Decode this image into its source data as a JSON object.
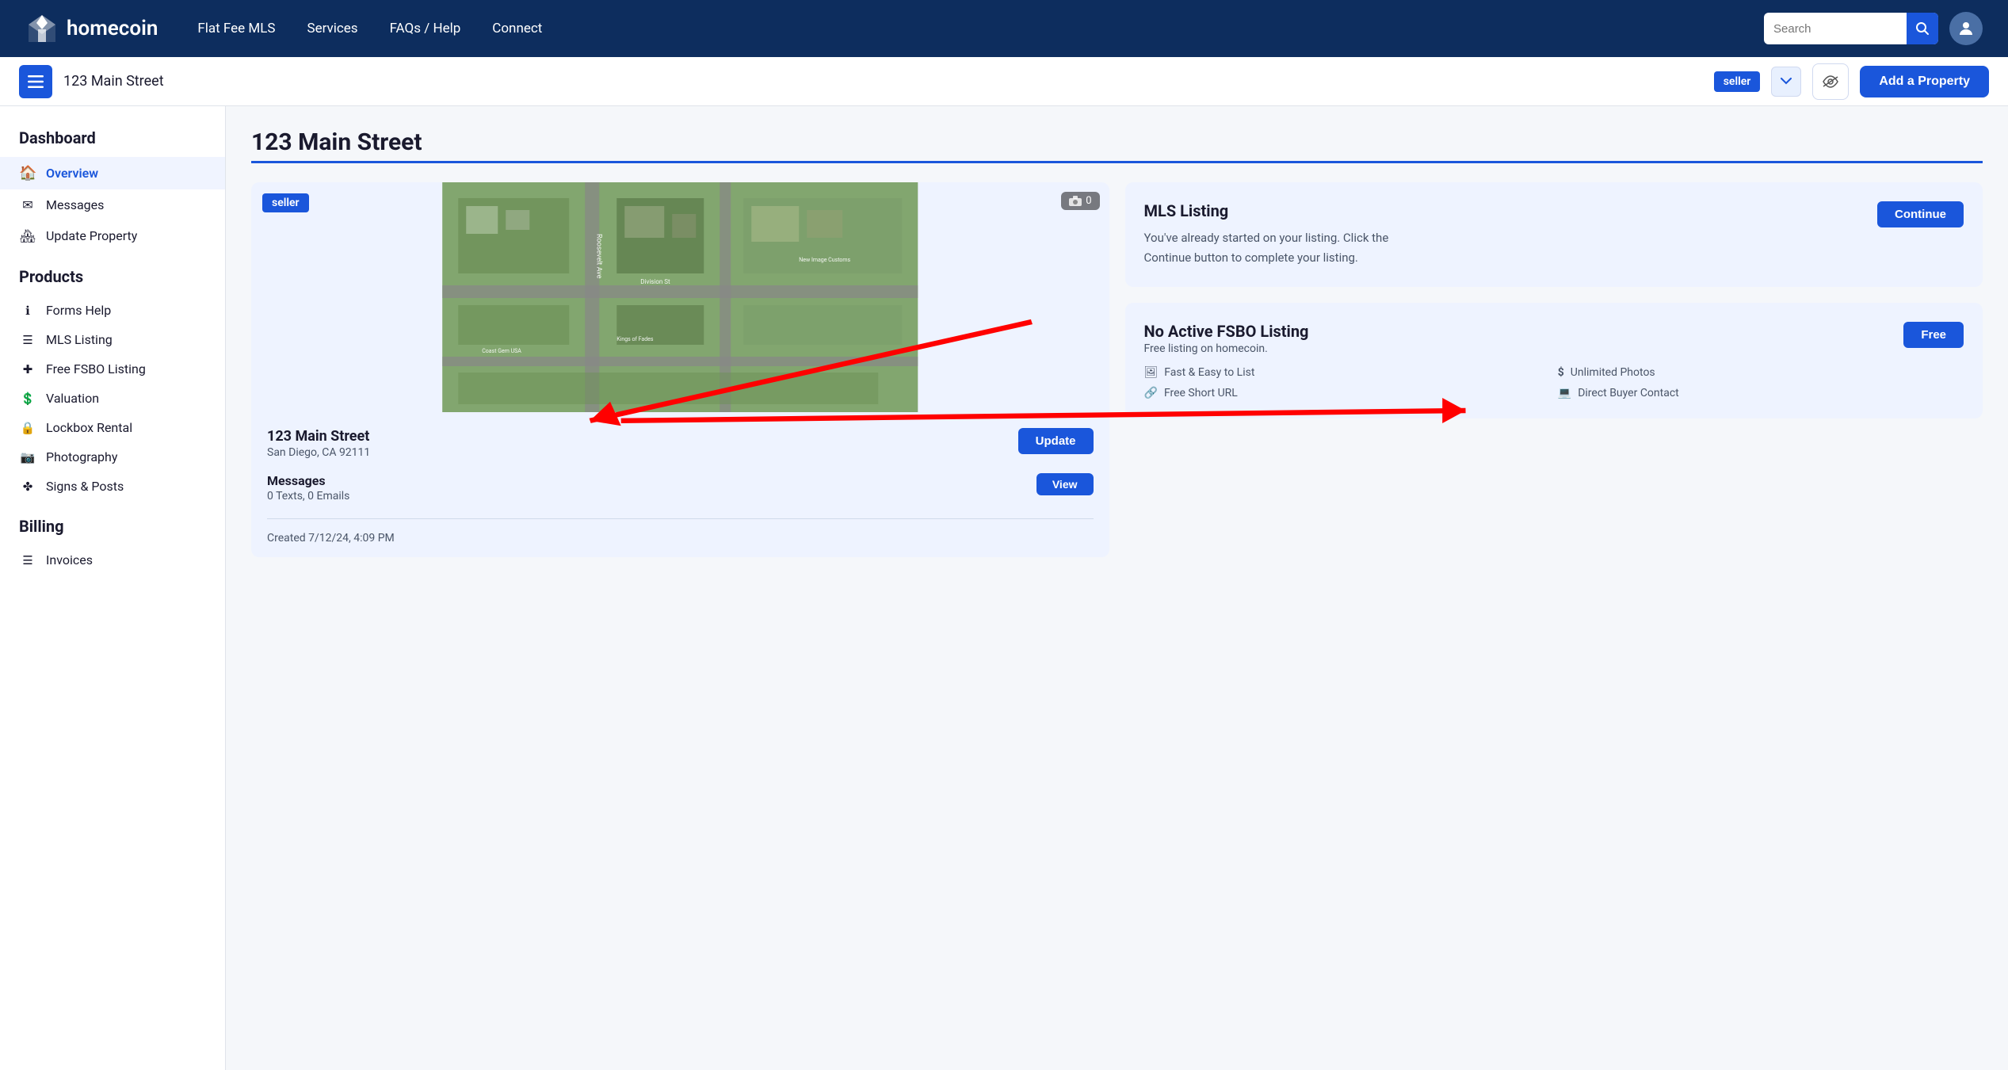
{
  "nav": {
    "logo_text": "homecoin",
    "links": [
      {
        "label": "Flat Fee MLS",
        "name": "flat-fee-mls"
      },
      {
        "label": "Services",
        "name": "services"
      },
      {
        "label": "FAQs / Help",
        "name": "faqs-help"
      },
      {
        "label": "Connect",
        "name": "connect"
      }
    ],
    "search_placeholder": "Search",
    "user_icon": "👤"
  },
  "toolbar": {
    "address": "123 Main Street",
    "seller_badge": "seller",
    "add_property_label": "Add a Property"
  },
  "sidebar": {
    "dashboard_title": "Dashboard",
    "items_top": [
      {
        "label": "Overview",
        "icon": "🏠",
        "name": "overview",
        "active": true
      },
      {
        "label": "Messages",
        "icon": "✉",
        "name": "messages",
        "active": false
      },
      {
        "label": "Update Property",
        "icon": "🏘",
        "name": "update-property",
        "active": false
      }
    ],
    "products_title": "Products",
    "items_products": [
      {
        "label": "Forms Help",
        "icon": "ℹ",
        "name": "forms-help"
      },
      {
        "label": "MLS Listing",
        "icon": "☰",
        "name": "mls-listing"
      },
      {
        "label": "Free FSBO Listing",
        "icon": "✚",
        "name": "free-fsbo-listing"
      },
      {
        "label": "Valuation",
        "icon": "💲",
        "name": "valuation"
      },
      {
        "label": "Lockbox Rental",
        "icon": "🔒",
        "name": "lockbox-rental"
      },
      {
        "label": "Photography",
        "icon": "📷",
        "name": "photography"
      },
      {
        "label": "Signs & Posts",
        "icon": "✤",
        "name": "signs-posts"
      }
    ],
    "billing_title": "Billing",
    "items_billing": [
      {
        "label": "Invoices",
        "icon": "☰",
        "name": "invoices"
      }
    ]
  },
  "content": {
    "page_title": "123 Main Street",
    "property": {
      "seller_tag": "seller",
      "camera_count": "0",
      "address": "123 Main Street",
      "city_state": "San Diego, CA 92111",
      "update_btn": "Update",
      "messages_label": "Messages",
      "messages_count": "0 Texts, 0 Emails",
      "view_btn": "View",
      "created": "Created 7/12/24, 4:09 PM"
    },
    "mls_card": {
      "title": "MLS Listing",
      "description": "You've already started on your listing. Click the Continue button to complete your listing.",
      "continue_btn": "Continue"
    },
    "fsbo_card": {
      "title": "No Active FSBO Listing",
      "subtitle": "Free listing on homecoin.",
      "free_btn": "Free",
      "features": [
        {
          "icon": "🖼",
          "text": "Fast & Easy to List"
        },
        {
          "icon": "$",
          "text": "Unlimited Photos"
        },
        {
          "icon": "🔗",
          "text": "Free Short URL"
        },
        {
          "icon": "💻",
          "text": "Direct Buyer Contact"
        }
      ]
    }
  }
}
